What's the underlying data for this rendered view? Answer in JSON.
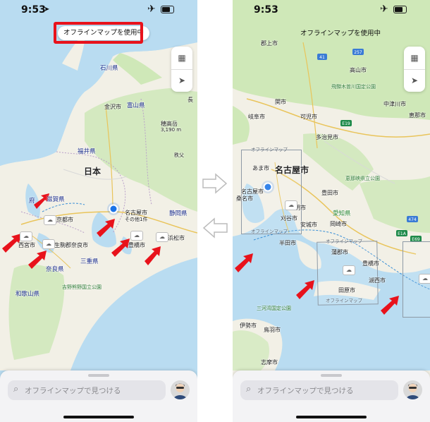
{
  "status": {
    "time": "9:53"
  },
  "offline_banner": "オフラインマップを使用中",
  "search": {
    "placeholder": "オフラインマップで見つける"
  },
  "colors": {
    "highlight": "#e8121b",
    "arrow": "#e8121b",
    "user_dot": "#1a73e8",
    "sea": "#b9dcf1",
    "land": "#f2f0e6",
    "forest": "#cfe8b8"
  },
  "left_map": {
    "prefectures": [
      "石川県",
      "富山県",
      "福井県",
      "滋賀県",
      "三重県",
      "奈良県",
      "和歌山県",
      "静岡県"
    ],
    "country": "日本",
    "cities": [
      "金沢市",
      "長",
      "京都市",
      "西宮市",
      "生駒郡奈良市",
      "豊橋市",
      "浜松市",
      "名古屋市",
      "その他1件"
    ],
    "peak": "穂高岳",
    "peak_elev": "3,190 m",
    "park": "吉野熊野国立公園",
    "extra": [
      "府",
      "秩父"
    ]
  },
  "right_map": {
    "cities": [
      "郡上市",
      "高山市",
      "飛騨木曽川国定公園",
      "中津川市",
      "関市",
      "恵那市",
      "岐阜市",
      "可児市",
      "多治見市",
      "名古屋市",
      "あま市",
      "名古屋市",
      "桑名市",
      "豊田市",
      "愛知県",
      "豊明市",
      "刈谷市",
      "安城市",
      "半田市",
      "岡崎市",
      "蒲郡市",
      "豊橋市",
      "湖西市",
      "田原市",
      "伊勢市",
      "鳥羽市",
      "志摩市",
      "三河湾国定公園",
      "恵那峡県立公園"
    ],
    "offline_labels": [
      "オフラインマップ",
      "オフラインマップ",
      "オフラインマップ",
      "オフラインマップ",
      "オフラインマップ"
    ],
    "route_badges": [
      "41",
      "257",
      "E19",
      "E1A",
      "E69",
      "474"
    ]
  },
  "icons": [
    "location-arrow-icon",
    "airplane-icon",
    "battery-icon",
    "map-icon",
    "navigation-icon",
    "search-icon",
    "avatar-icon",
    "download-icon"
  ]
}
